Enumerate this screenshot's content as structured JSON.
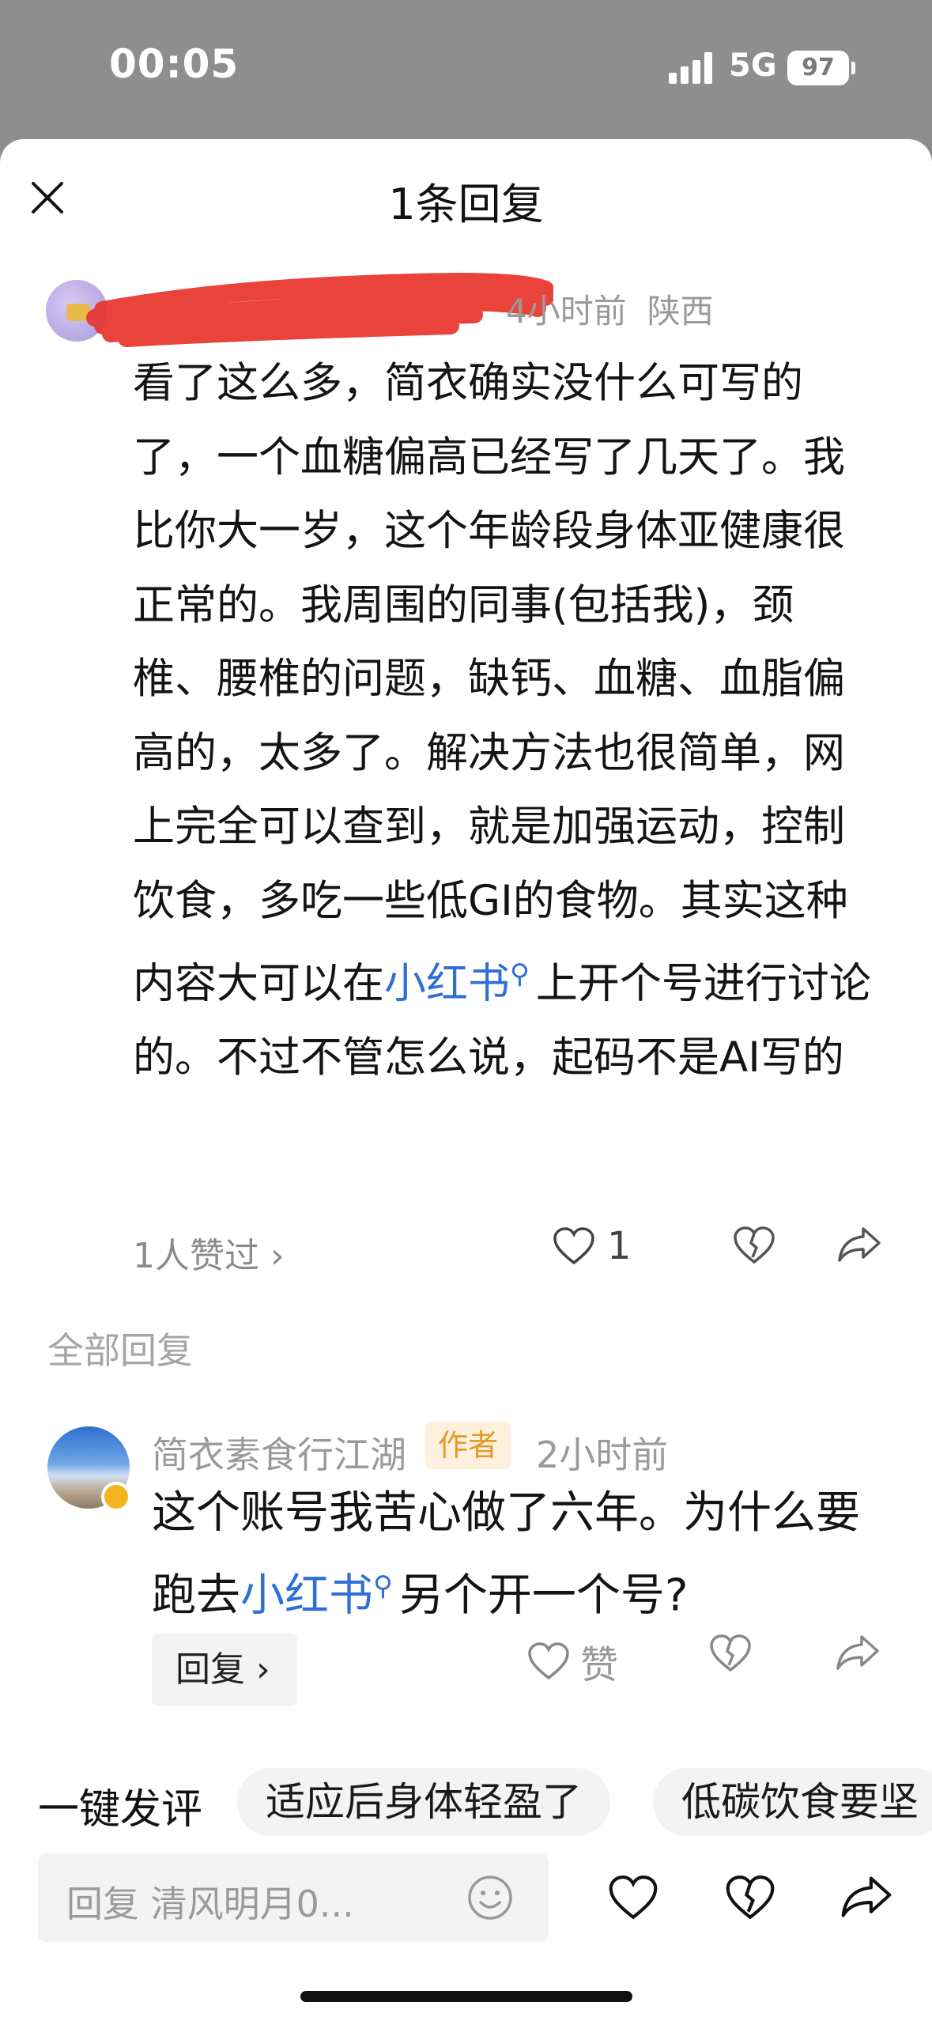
{
  "status_bar": {
    "time": "00:05",
    "network": "5G",
    "battery": "97"
  },
  "sheet": {
    "title": "1条回复"
  },
  "comment": {
    "time": "4小时前",
    "location": "陕西",
    "text_before": "看了这么多，简衣确实没什么可写的了，一个血糖偏高已经写了几天了。我比你大一岁，这个年龄段身体亚健康很正常的。我周围的同事(包括我)，颈椎、腰椎的问题，缺钙、血糖、血脂偏高的，太多了。解决方法也很简单，网上完全可以查到，就是加强运动，控制饮食，多吃一些低GI的食物。其实这种内容大可以在",
    "highlight": "小红书",
    "text_after": "上开个号进行讨论的。不过不管怎么说，起码不是AI写的",
    "likes_summary": "1人赞过",
    "like_count": "1"
  },
  "all_replies_label": "全部回复",
  "reply": {
    "author": "简衣素食行江湖",
    "author_tag": "作者",
    "time": "2小时前",
    "text_before": "这个账号我苦心做了六年。为什么要跑去",
    "highlight": "小红书",
    "text_after": "另个开一个号?",
    "reply_button": "回复",
    "like_label": "赞"
  },
  "quick_comments": {
    "label": "一键发评",
    "chips": [
      "适应后身体轻盈了",
      "低碳饮食要坚"
    ]
  },
  "input": {
    "placeholder": "回复 清风明月0..."
  },
  "colors": {
    "link": "#2f6fd6",
    "author_tag_bg": "#fdf1de",
    "author_tag_fg": "#e39a2a",
    "redaction": "#e8332a"
  }
}
